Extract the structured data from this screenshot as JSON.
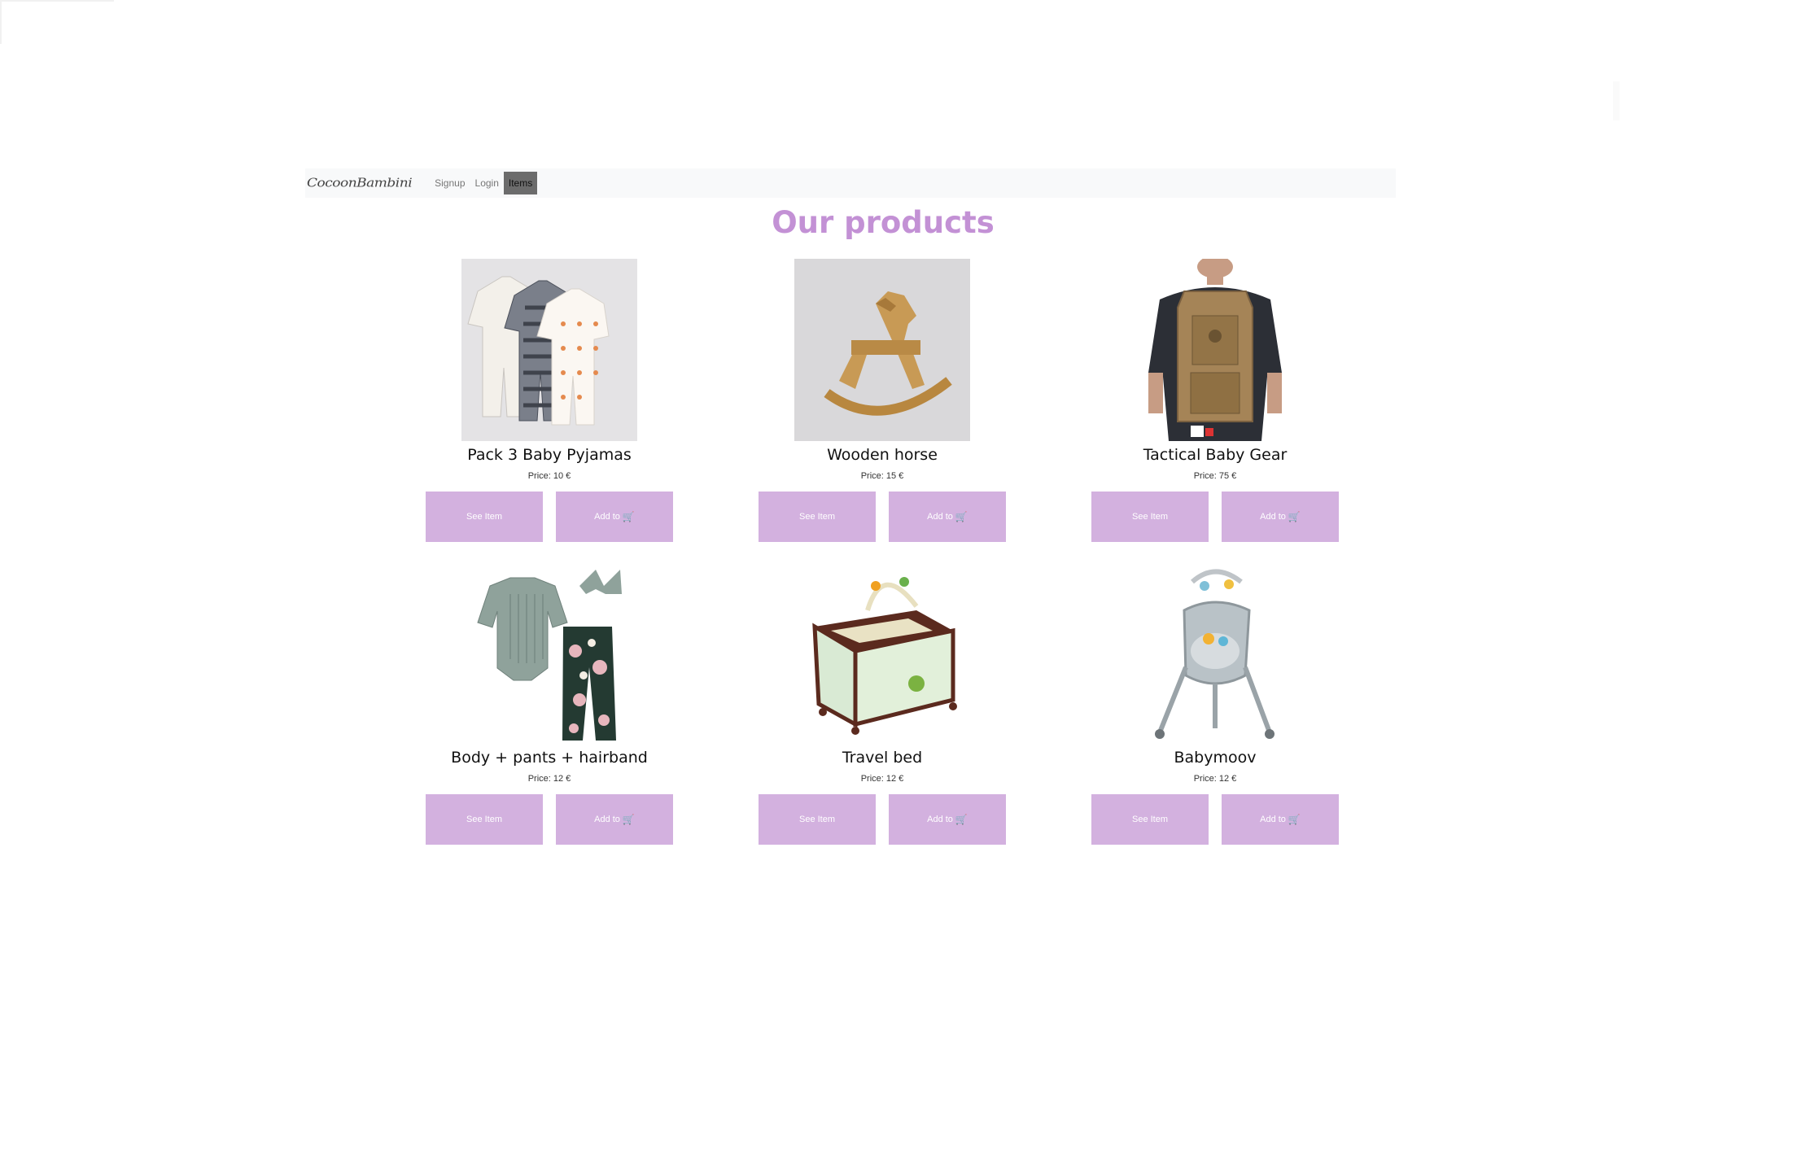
{
  "navbar": {
    "brand": "CocoonBambini",
    "links": [
      {
        "label": "Signup",
        "active": false
      },
      {
        "label": "Login",
        "active": false
      },
      {
        "label": "Items",
        "active": true
      }
    ]
  },
  "page": {
    "title": "Our products"
  },
  "products": [
    {
      "name": "Pack 3 Baby Pyjamas",
      "price": "Price: 10 €",
      "see_label": "See Item",
      "add_label": "Add to",
      "cart_icon": "cart-icon"
    },
    {
      "name": "Wooden horse",
      "price": "Price: 15 €",
      "see_label": "See Item",
      "add_label": "Add to",
      "cart_icon": "cart-icon"
    },
    {
      "name": "Tactical Baby Gear",
      "price": "Price: 75 €",
      "see_label": "See Item",
      "add_label": "Add to",
      "cart_icon": "cart-icon"
    },
    {
      "name": "Body + pants + hairband",
      "price": "Price: 12 €",
      "see_label": "See Item",
      "add_label": "Add to",
      "cart_icon": "cart-icon"
    },
    {
      "name": "Travel bed",
      "price": "Price: 12 €",
      "see_label": "See Item",
      "add_label": "Add to",
      "cart_icon": "cart-icon"
    },
    {
      "name": "Babymoov",
      "price": "Price: 12 €",
      "see_label": "See Item",
      "add_label": "Add to",
      "cart_icon": "cart-icon"
    }
  ],
  "colors": {
    "accent": "#c391d5",
    "button": "#d3b1df",
    "navbar": "#f8f9fa"
  }
}
